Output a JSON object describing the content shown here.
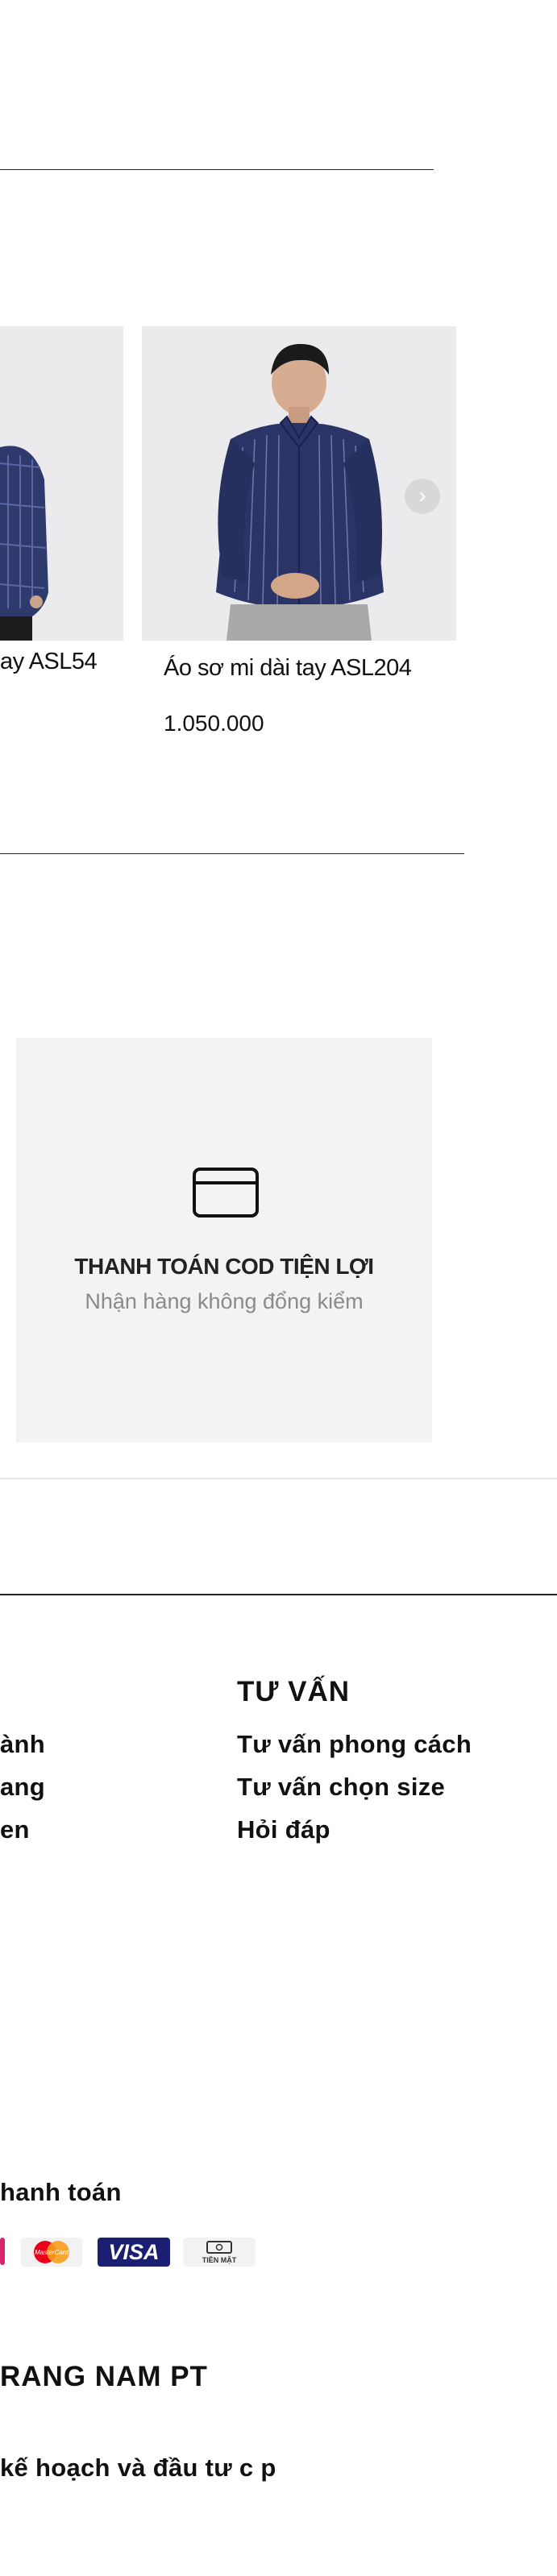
{
  "products": [
    {
      "name": "ay ASL54"
    },
    {
      "name": "Áo sơ mi dài tay ASL204",
      "price": "1.050.000"
    }
  ],
  "carousel": {
    "next_glyph": "›"
  },
  "feature": {
    "title": "THANH TOÁN COD TIỆN LỢI",
    "subtitle": "Nhận hàng không đổng kiểm"
  },
  "footer": {
    "col1_links": [
      "ành",
      "ang",
      "en"
    ],
    "consult": {
      "heading": "TƯ VẤN",
      "links": [
        "Tư  vấn phong cách",
        "Tư  vấn chọn size",
        "Hỏi  đáp"
      ]
    },
    "payment": {
      "heading": "hanh toán",
      "methods": [
        "MasterCard",
        "VISA",
        "TIỀN MẶT"
      ]
    },
    "company": {
      "heading": "RANG NAM PT",
      "line": "kế  hoạch và   đầu tư   c p"
    }
  },
  "colors": {
    "visa_blue": "#1a1f71",
    "mastercard_red": "#eb001b",
    "mastercard_yellow": "#f79e1b",
    "pink_card": "#d6246e"
  }
}
